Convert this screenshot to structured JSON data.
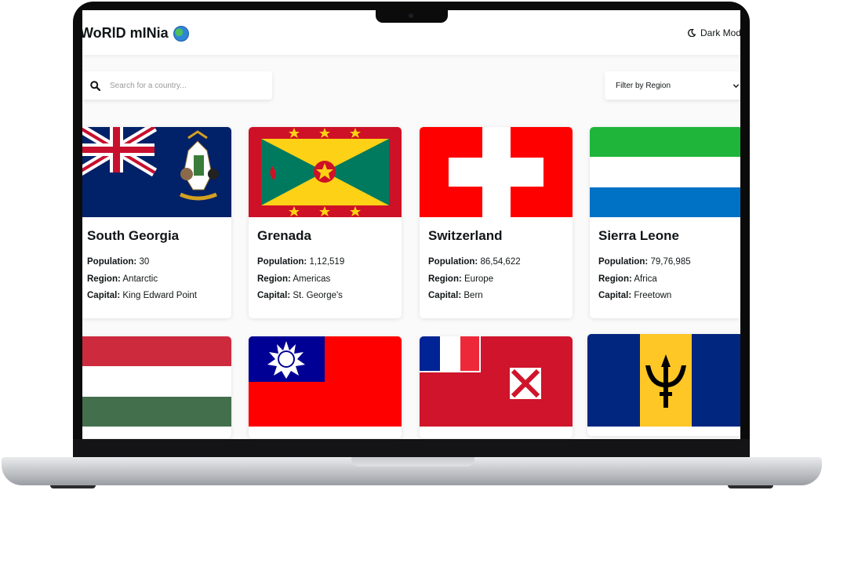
{
  "header": {
    "logo_text": "WoRlD mINia",
    "logo_icon": "globe-icon",
    "dark_mode_label": "Dark Mode",
    "dark_mode_icon": "moon-icon"
  },
  "search": {
    "placeholder": "Search for a country...",
    "icon": "search-icon"
  },
  "filter": {
    "label": "Filter by Region",
    "icon": "chevron-down-icon"
  },
  "labels": {
    "population": "Population:",
    "region": "Region:",
    "capital": "Capital:"
  },
  "countries": [
    {
      "name": "South Georgia",
      "population": "30",
      "region": "Antarctic",
      "capital": "King Edward Point"
    },
    {
      "name": "Grenada",
      "population": "1,12,519",
      "region": "Americas",
      "capital": "St. George's"
    },
    {
      "name": "Switzerland",
      "population": "86,54,622",
      "region": "Europe",
      "capital": "Bern"
    },
    {
      "name": "Sierra Leone",
      "population": "79,76,985",
      "region": "Africa",
      "capital": "Freetown"
    }
  ],
  "theme": {
    "background": "#fafafa",
    "card": "#ffffff",
    "text": "#111517"
  }
}
